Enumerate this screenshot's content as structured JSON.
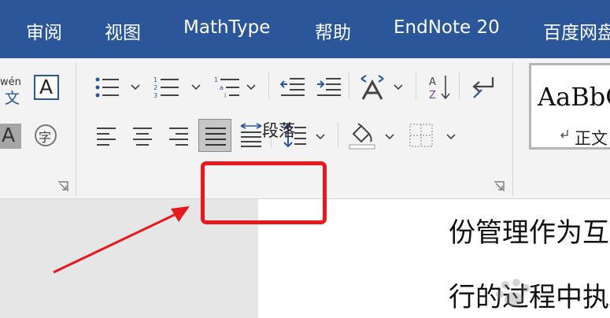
{
  "tabs": [
    {
      "label": "审阅"
    },
    {
      "label": "视图"
    },
    {
      "label": "MathType"
    },
    {
      "label": "帮助"
    },
    {
      "label": "EndNote 20"
    },
    {
      "label": "百度网盘"
    }
  ],
  "font_group": {
    "phonetic_guide_label": "wén",
    "phonetic_guide_char": "文",
    "char_border_glyph": "A",
    "char_shading_glyph": "A",
    "enclose_char_glyph": "字"
  },
  "paragraph_group": {
    "label": "段落",
    "sort_icon_letters": [
      "A",
      "Z"
    ]
  },
  "styles_group": {
    "preview_text": "AaBbC",
    "style_name": "正文"
  },
  "document": {
    "lines": [
      "份管理作为互",
      "行的过程中执"
    ]
  },
  "colors": {
    "tab_bar": "#2b579a",
    "ribbon": "#f3f3f3",
    "highlight": "#e8191c",
    "annotation_arrow": "#e8191c"
  }
}
